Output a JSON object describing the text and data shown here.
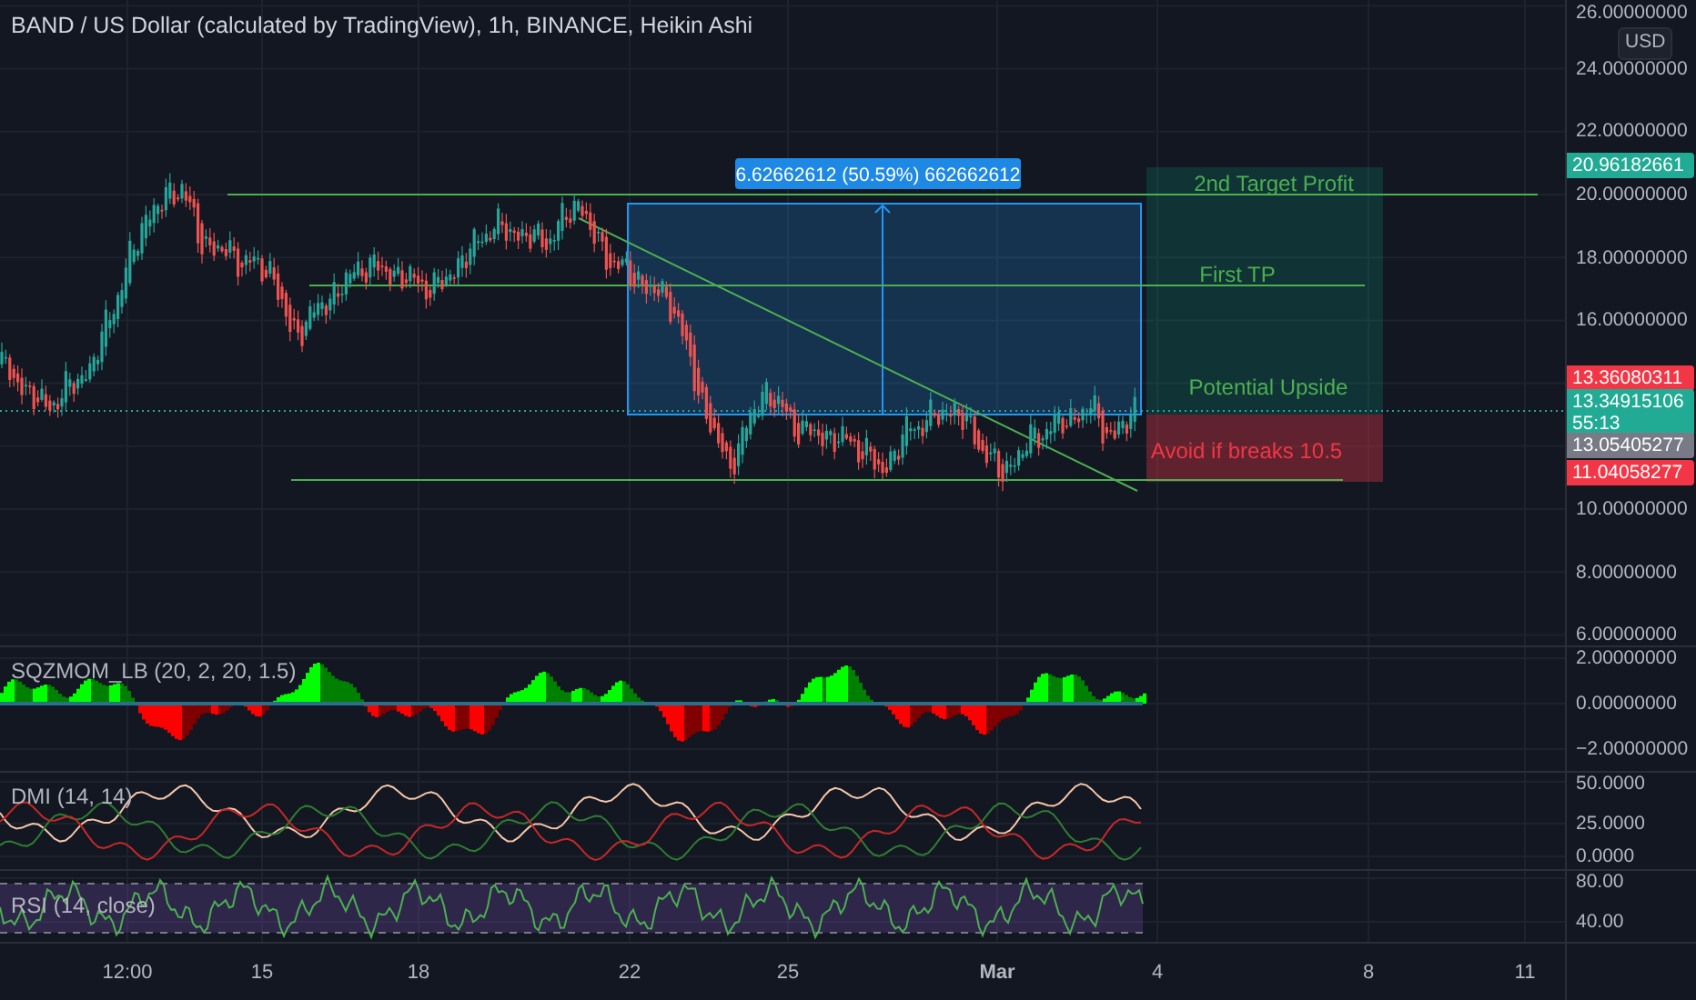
{
  "chart": {
    "title": "BAND / US Dollar (calculated by TradingView), 1h, BINANCE, Heikin Ashi",
    "currency": "USD",
    "price_axis": [
      "26.00000000",
      "24.00000000",
      "22.00000000",
      "20.00000000",
      "18.00000000",
      "16.00000000",
      "10.00000000",
      "8.00000000",
      "6.00000000"
    ],
    "price_tags": [
      {
        "kind": "price",
        "value": "20.96182661",
        "color": "#22ab94"
      },
      {
        "kind": "price",
        "value": "13.36080311",
        "color": "#f23645"
      },
      {
        "kind": "countdown",
        "value": "13.34915106",
        "countdown": "55:13",
        "color": "#22ab94"
      },
      {
        "kind": "price",
        "value": "13.05405277",
        "color": "#787b86"
      },
      {
        "kind": "price",
        "value": "11.04058277",
        "color": "#f23645"
      }
    ],
    "measure_label": "6.62662612 (50.59%) 662662612",
    "zone_labels": [
      {
        "kind": "profit",
        "text": "2nd Target Profit"
      },
      {
        "kind": "profit",
        "text": "First TP"
      },
      {
        "kind": "profit",
        "text": "Potential Upside"
      },
      {
        "kind": "loss",
        "text": "Avoid if breaks 10.5"
      }
    ]
  },
  "indicators": [
    {
      "title": "SQZMOM_LB (20, 2, 20, 1.5)",
      "axis": [
        "2.00000000",
        "0.00000000",
        "−2.00000000"
      ]
    },
    {
      "title": "DMI (14, 14)",
      "axis": [
        "50.0000",
        "25.0000",
        "0.0000"
      ]
    },
    {
      "title": "RSI (14, close)",
      "axis": [
        "80.00",
        "40.00"
      ]
    }
  ],
  "time_axis": [
    {
      "kind": "time",
      "label": "12:00"
    },
    {
      "kind": "day",
      "label": "15"
    },
    {
      "kind": "day",
      "label": "18"
    },
    {
      "kind": "day",
      "label": "22"
    },
    {
      "kind": "day",
      "label": "25"
    },
    {
      "kind": "month",
      "label": "Mar"
    },
    {
      "kind": "day",
      "label": "4"
    },
    {
      "kind": "day",
      "label": "8"
    },
    {
      "kind": "day",
      "label": "11"
    }
  ]
}
